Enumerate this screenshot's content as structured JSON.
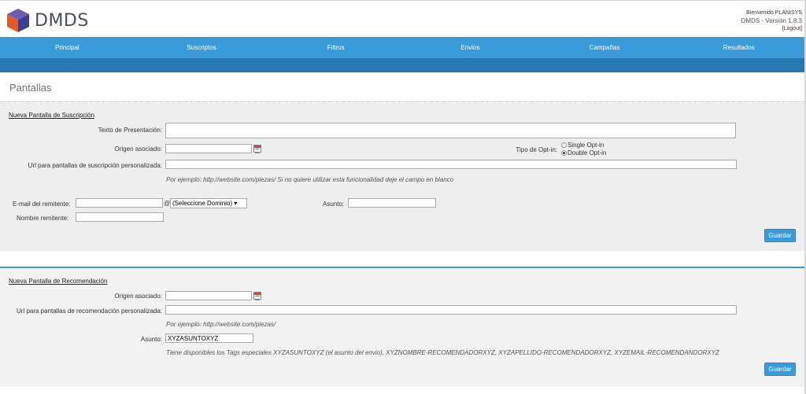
{
  "header": {
    "brand": "DMDS",
    "welcome": "Bienvenido PLANISYS",
    "version": "DMDS - Versión 1.8.3",
    "logout": "[Logout]"
  },
  "nav": [
    "Principal",
    "Suscriptos",
    "Filtros",
    "Envios",
    "Campañas",
    "Resultados"
  ],
  "page_title": "Pantallas",
  "subscription": {
    "title": "Nueva Pantalla de Suscripción",
    "presentation_label": "Texto de Presentación:",
    "presentation_value": "",
    "origin_label": "Origen asociado:",
    "origin_value": "",
    "optin_label": "Tipo de Opt-in:",
    "optin_options": [
      "Single Opt-in",
      "Double Opt-in"
    ],
    "optin_selected": "Double Opt-in",
    "url_label": "Url para pantallas de suscripción personalizada:",
    "url_value": "",
    "url_hint": "Por ejemplo: http://website.com/piezas/ Si no quiere utilizar esta funcionalidad deje el campo en blanco",
    "email_label": "E-mail del remitente:",
    "email_value": "",
    "at_sign": "@",
    "domain_select": "(Seleccione Dominio) ▾",
    "subject_label": "Asunto:",
    "subject_value": "",
    "sender_label": "Nombre remitente:",
    "sender_value": "",
    "save": "Guardar"
  },
  "recommendation": {
    "title": "Nueva Pantalla de Recomendación",
    "origin_label": "Origen asociado:",
    "origin_value": "",
    "url_label": "Url para pantallas de recomendación personalizada:",
    "url_value": "",
    "url_hint": "Por ejemplo: http://website.com/piezas/",
    "subject_label": "Asunto:",
    "subject_value": "XYZASUNTOXYZ",
    "tags_hint": "Tiene disponibles los Tags especiales XYZASUNTOXYZ (el asunto del envio), XYZNOMBRE-RECOMENDADORXYZ, XYZAPELLIDO-RECOMENDADORXYZ, XYZEMAIL-RECOMENDANDORXYZ",
    "save": "Guardar"
  }
}
